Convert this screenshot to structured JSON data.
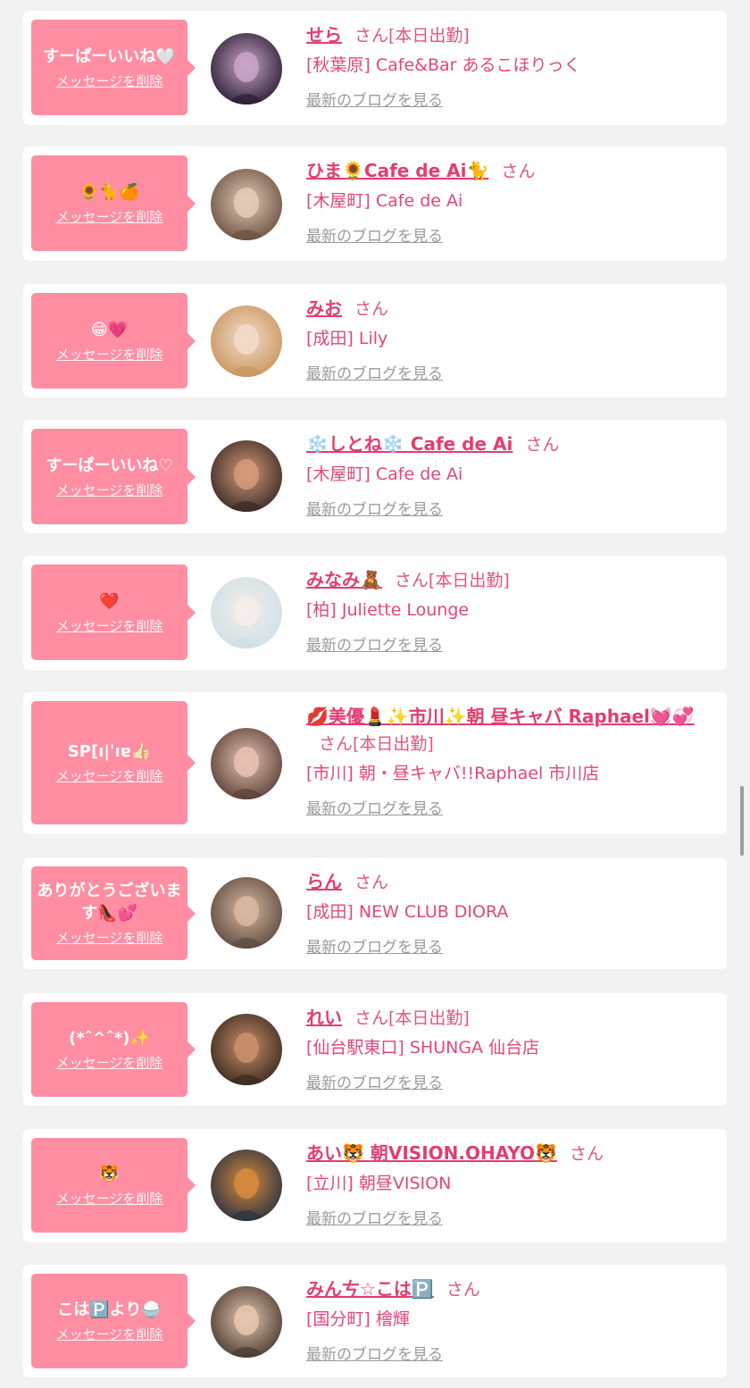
{
  "messages": [
    {
      "message": "すーぱーいいね🤍",
      "delete_label": "メッセージを削除",
      "name": "せら",
      "honorific": "さん",
      "badge": "[本日出勤]",
      "shop": "[秋葉原] Cafe&Bar あるこほりっく",
      "blog_link": "最新のブログを見る",
      "avatar_colors": [
        "#2b1d33",
        "#c9a6c7"
      ]
    },
    {
      "message": "🌻🐈🍊",
      "delete_label": "メッセージを削除",
      "name": "ひま🌻Cafe de Ai🐈",
      "honorific": "さん",
      "badge": "",
      "shop": "[木屋町] Cafe de Ai",
      "blog_link": "最新のブログを見る",
      "avatar_colors": [
        "#6b5140",
        "#e3cbb8"
      ]
    },
    {
      "message": "😁💗",
      "delete_label": "メッセージを削除",
      "name": "みお",
      "honorific": "さん",
      "badge": "",
      "shop": "[成田] Lily",
      "blog_link": "最新のブログを見る",
      "avatar_colors": [
        "#c9955e",
        "#f2dcc8"
      ]
    },
    {
      "message": "すーぱーいいね♡",
      "delete_label": "メッセージを削除",
      "name": "❄️しとね❄️ Cafe de Ai",
      "honorific": "さん",
      "badge": "",
      "shop": "[木屋町] Cafe de Ai",
      "blog_link": "最新のブログを見る",
      "avatar_colors": [
        "#3a2a25",
        "#d49a7a"
      ]
    },
    {
      "message": "❤️",
      "delete_label": "メッセージを削除",
      "name": "みなみ🧸",
      "honorific": "さん",
      "badge": "[本日出勤]",
      "shop": "[柏] Juliette Lounge",
      "blog_link": "最新のブログを見る",
      "avatar_colors": [
        "#cfe0e6",
        "#f4eeea"
      ]
    },
    {
      "message": "SP[ı|ˈıɐ👍🏻",
      "delete_label": "メッセージを削除",
      "name": "💋美優💄✨市川✨朝 昼キャバ Raphael💓💞",
      "honorific": "さん",
      "badge": "[本日出勤]",
      "shop": "[市川] 朝・昼キャバ!!Raphael 市川店",
      "blog_link": "最新のブログを見る",
      "avatar_colors": [
        "#5a4036",
        "#e8c2b3"
      ]
    },
    {
      "message": "ありがとうございます👠💕",
      "delete_label": "メッセージを削除",
      "name": "らん",
      "honorific": "さん",
      "badge": "",
      "shop": "[成田] NEW CLUB DIORA",
      "blog_link": "最新のブログを見る",
      "avatar_colors": [
        "#5d4a3e",
        "#d9b8a2"
      ]
    },
    {
      "message": "(*ˆ^ˆ*)✨",
      "delete_label": "メッセージを削除",
      "name": "れい",
      "honorific": "さん",
      "badge": "[本日出勤]",
      "shop": "[仙台駅東口] SHUNGA 仙台店",
      "blog_link": "最新のブログを見る",
      "avatar_colors": [
        "#3b2a1f",
        "#c98f6a"
      ]
    },
    {
      "message": "🐯",
      "delete_label": "メッセージを削除",
      "name": "あい🐯 朝VISION.OHAYO🐯",
      "honorific": "さん",
      "badge": "",
      "shop": "[立川] 朝昼VISION",
      "blog_link": "最新のブログを見る",
      "avatar_colors": [
        "#2a3340",
        "#d88a3e"
      ]
    },
    {
      "message": "こは🅿️より🍚",
      "delete_label": "メッセージを削除",
      "name": "みんㄘ☆こは🅿️",
      "honorific": "さん",
      "badge": "",
      "shop": "[国分町] 檜輝",
      "blog_link": "最新のブログを見る",
      "avatar_colors": [
        "#4a3a30",
        "#e6c7b0"
      ]
    }
  ]
}
